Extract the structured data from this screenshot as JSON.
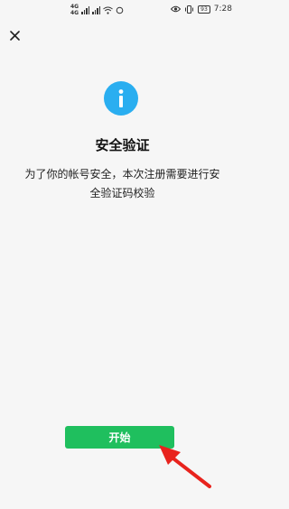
{
  "status_bar": {
    "net_top": "4G",
    "net_bottom": "4G",
    "battery": "93",
    "time": "7:28"
  },
  "dialog": {
    "title": "安全验证",
    "description": "为了你的帐号安全，本次注册需要进行安全验证码校验",
    "start_button": "开始"
  },
  "colors": {
    "accent_blue": "#2aaef0",
    "button_green": "#1fbf5e",
    "annotation_red": "#e8231d"
  },
  "icons": [
    "close-icon",
    "info-icon",
    "wifi-icon",
    "eye-icon",
    "vibrate-icon",
    "battery-icon"
  ]
}
